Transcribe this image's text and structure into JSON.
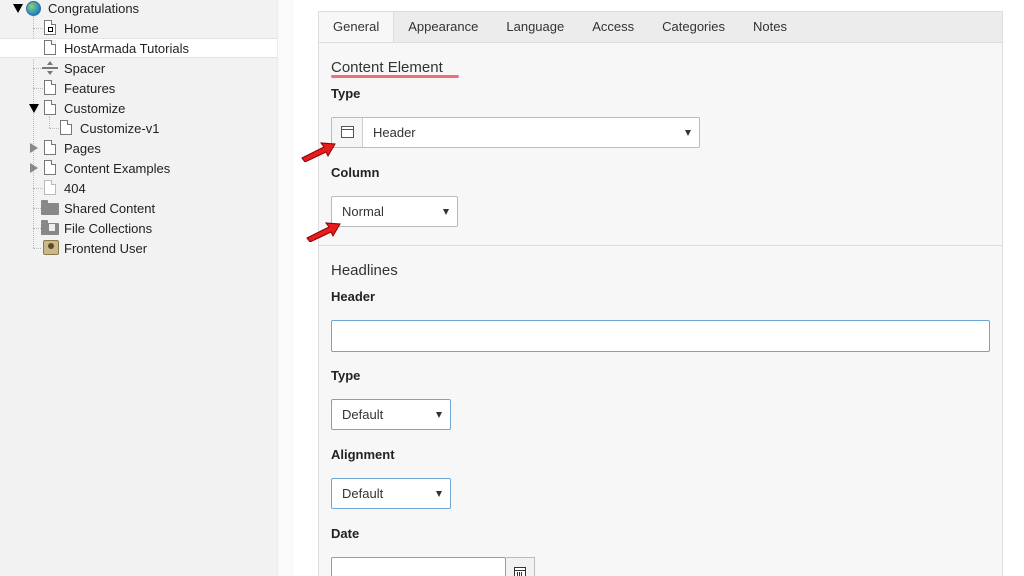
{
  "tree": {
    "items": [
      {
        "label": "Congratulations"
      },
      {
        "label": "Home"
      },
      {
        "label": "HostArmada Tutorials"
      },
      {
        "label": "Spacer"
      },
      {
        "label": "Features"
      },
      {
        "label": "Customize"
      },
      {
        "label": "Customize-v1"
      },
      {
        "label": "Pages"
      },
      {
        "label": "Content Examples"
      },
      {
        "label": "404"
      },
      {
        "label": "Shared Content"
      },
      {
        "label": "File Collections"
      },
      {
        "label": "Frontend User"
      }
    ]
  },
  "tabs": [
    {
      "label": "General",
      "active": true
    },
    {
      "label": "Appearance"
    },
    {
      "label": "Language"
    },
    {
      "label": "Access"
    },
    {
      "label": "Categories"
    },
    {
      "label": "Notes"
    }
  ],
  "form": {
    "content_element": {
      "title": "Content Element",
      "type_label": "Type",
      "type_value": "Header",
      "column_label": "Column",
      "column_value": "Normal"
    },
    "headlines": {
      "title": "Headlines",
      "header_label": "Header",
      "header_value": "",
      "type_label": "Type",
      "type_value": "Default",
      "alignment_label": "Alignment",
      "alignment_value": "Default",
      "date_label": "Date",
      "date_value": ""
    }
  },
  "colors": {
    "annotation_underline": "#f0707a",
    "annotation_arrow": "#e81c1c",
    "focus_border": "#6ea6d8"
  }
}
